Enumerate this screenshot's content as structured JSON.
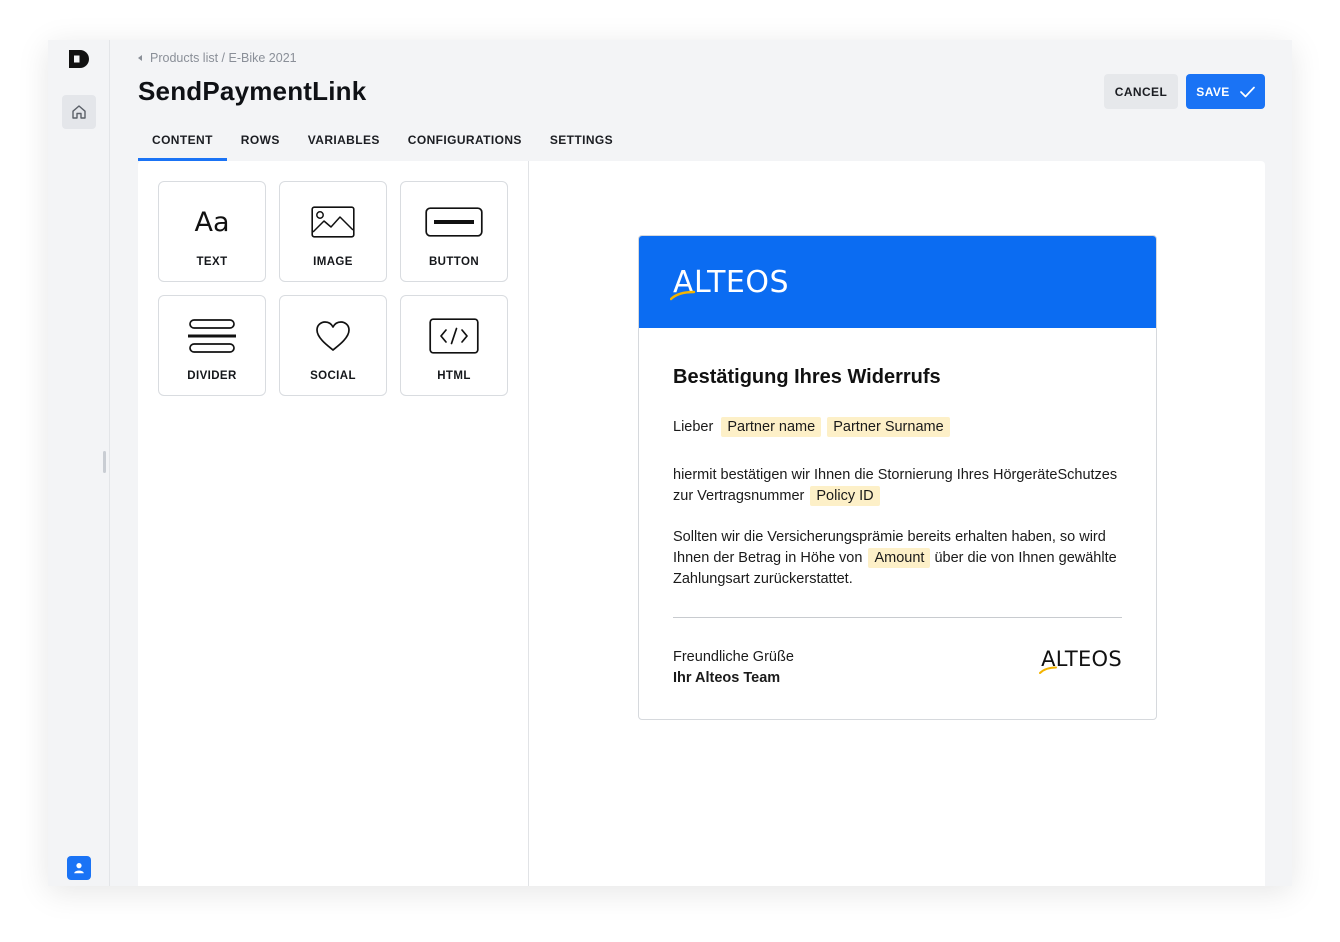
{
  "app": {
    "logo_icon": "dash-logo-icon",
    "home_icon": "home-icon",
    "user_icon": "user-icon",
    "accent_color": "#1a73f5"
  },
  "header": {
    "breadcrumb": "Products list / E-Bike 2021",
    "title": "SendPaymentLink",
    "cancel_label": "CANCEL",
    "save_label": "SAVE"
  },
  "tabs": [
    {
      "label": "CONTENT",
      "active": true
    },
    {
      "label": "ROWS",
      "active": false
    },
    {
      "label": "VARIABLES",
      "active": false
    },
    {
      "label": "CONFIGURATIONS",
      "active": false
    },
    {
      "label": "SETTINGS",
      "active": false
    }
  ],
  "tools": [
    {
      "label": "TEXT",
      "icon": "text-aa-icon",
      "glyph": "Aa"
    },
    {
      "label": "IMAGE",
      "icon": "image-icon"
    },
    {
      "label": "BUTTON",
      "icon": "button-icon"
    },
    {
      "label": "DIVIDER",
      "icon": "divider-icon"
    },
    {
      "label": "SOCIAL",
      "icon": "heart-icon"
    },
    {
      "label": "HTML",
      "icon": "code-icon"
    }
  ],
  "email": {
    "header_color": "#0b6cf2",
    "brand": "ALTEOS",
    "title": "Bestätigung Ihres Widerrufs",
    "greeting": "Lieber",
    "var_partner_name": "Partner name",
    "var_partner_surname": "Partner Surname",
    "p1_text": "hiermit bestätigen wir Ihnen die Stornierung Ihres HörgeräteSchutzes zur Vertragsnummer",
    "var_policy_id": "Policy ID",
    "p2_before": "Sollten wir die Versicherungsprämie bereits erhalten haben, so wird Ihnen der Betrag in Höhe von",
    "var_amount": "Amount",
    "p2_after": "über die von Ihnen gewählte Zahlungsart zurückerstattet.",
    "closing": "Freundliche Grüße",
    "signature": "Ihr Alteos Team",
    "variable_highlight_color": "#fdf0c8"
  }
}
